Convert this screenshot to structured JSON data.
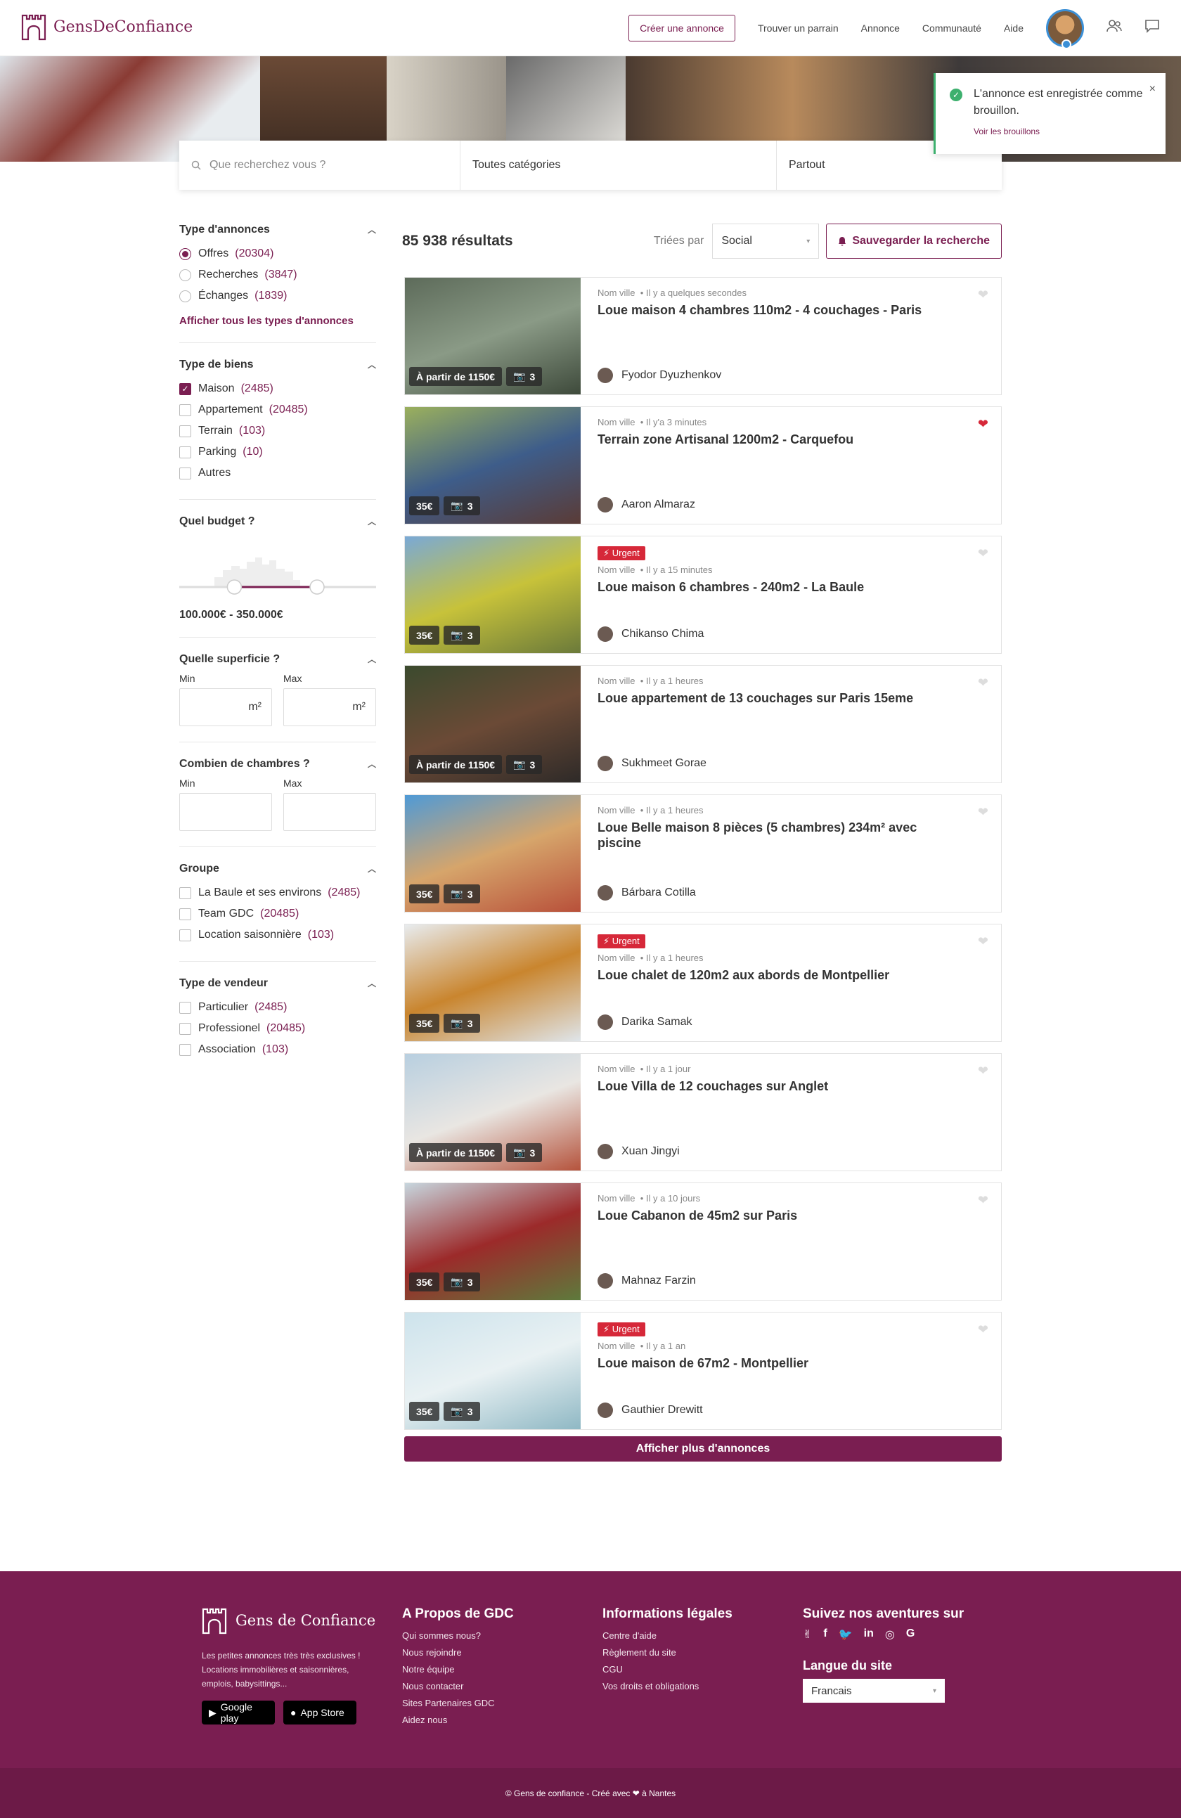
{
  "header": {
    "brand": "GensDeConfiance",
    "create_btn": "Créer une annonce",
    "nav": [
      "Trouver un parrain",
      "Annonce",
      "Communauté",
      "Aide"
    ]
  },
  "toast": {
    "message": "L'annonce est enregistrée comme brouillon.",
    "link": "Voir les brouillons",
    "close": "×"
  },
  "search": {
    "placeholder": "Que recherchez vous ?",
    "category": "Toutes catégories",
    "location": "Partout"
  },
  "filters": {
    "ad_type": {
      "title": "Type d'annonces",
      "options": [
        {
          "label": "Offres",
          "count": "(20304)",
          "checked": true
        },
        {
          "label": "Recherches",
          "count": "(3847)",
          "checked": false
        },
        {
          "label": "Échanges",
          "count": "(1839)",
          "checked": false
        }
      ],
      "show_all": "Afficher tous les types d'annonces"
    },
    "property_type": {
      "title": "Type de biens",
      "options": [
        {
          "label": "Maison",
          "count": "(2485)",
          "checked": true
        },
        {
          "label": "Appartement",
          "count": "(20485)",
          "checked": false
        },
        {
          "label": "Terrain",
          "count": "(103)",
          "checked": false
        },
        {
          "label": "Parking",
          "count": "(10)",
          "checked": false
        },
        {
          "label": "Autres",
          "count": "",
          "checked": false
        }
      ]
    },
    "budget": {
      "title": "Quel budget ?",
      "value": "100.000€ - 350.000€",
      "range_min_fraction": 0.28,
      "range_max_fraction": 0.7
    },
    "surface": {
      "title": "Quelle superficie ?",
      "min_label": "Min",
      "max_label": "Max",
      "unit": "m²"
    },
    "rooms": {
      "title": "Combien de chambres ?",
      "min_label": "Min",
      "max_label": "Max"
    },
    "group": {
      "title": "Groupe",
      "options": [
        {
          "label": "La Baule et ses environs",
          "count": "(2485)",
          "checked": false
        },
        {
          "label": "Team GDC",
          "count": "(20485)",
          "checked": false
        },
        {
          "label": "Location saisonnière",
          "count": "(103)",
          "checked": false
        }
      ]
    },
    "seller_type": {
      "title": "Type de vendeur",
      "options": [
        {
          "label": "Particulier",
          "count": "(2485)",
          "checked": false
        },
        {
          "label": "Professionel",
          "count": "(20485)",
          "checked": false
        },
        {
          "label": "Association",
          "count": "(103)",
          "checked": false
        }
      ]
    }
  },
  "results": {
    "count": "85 938 résultats",
    "sort_label": "Triées par",
    "sort_value": "Social",
    "save_search": "Sauvegarder la recherche",
    "more": "Afficher plus d'annonces",
    "listings": [
      {
        "city": "Nom ville",
        "time": "Il y a quelques secondes",
        "title": "Loue maison 4 chambres 110m2 - 4 couchages - Paris",
        "seller": "Fyodor Dyuzhenkov",
        "price": "À partir de 1150€",
        "photos": "3",
        "urgent": false,
        "liked": false,
        "img": [
          "#5d6b5a",
          "#8a9a86",
          "#3e4a3b"
        ]
      },
      {
        "city": "Nom ville",
        "time": "Il y'a 3 minutes",
        "title": "Terrain zone Artisanal  1200m2 - Carquefou",
        "seller": "Aaron Almaraz",
        "price": "35€",
        "photos": "3",
        "urgent": false,
        "liked": true,
        "img": [
          "#9bb05d",
          "#3e5d8a",
          "#5a3b36"
        ]
      },
      {
        "city": "Nom ville",
        "time": "Il y a 15 minutes",
        "title": "Loue maison 6 chambres - 240m2 - La Baule",
        "seller": "Chikanso Chima",
        "price": "35€",
        "photos": "3",
        "urgent": true,
        "liked": false,
        "img": [
          "#7aa9d6",
          "#c7c23a",
          "#6b7a3a"
        ]
      },
      {
        "city": "Nom ville",
        "time": "Il y a 1 heures",
        "title": "Loue appartement de 13 couchages sur Paris 15eme",
        "seller": "Sukhmeet Gorae",
        "price": "À partir de 1150€",
        "photos": "3",
        "urgent": false,
        "liked": false,
        "img": [
          "#3b4a2e",
          "#6b4a36",
          "#2e2a28"
        ]
      },
      {
        "city": "Nom ville",
        "time": "Il y a 1 heures",
        "title": "Loue Belle maison 8 pièces (5 chambres) 234m² avec piscine",
        "seller": "Bárbara Cotilla",
        "price": "35€",
        "photos": "3",
        "urgent": false,
        "liked": false,
        "img": [
          "#4f9ad6",
          "#d6a56b",
          "#b8503a"
        ]
      },
      {
        "city": "Nom ville",
        "time": "Il y a 1 heures",
        "title": "Loue chalet de 120m2 aux abords de Montpellier",
        "seller": "Darika Samak",
        "price": "35€",
        "photos": "3",
        "urgent": true,
        "liked": false,
        "img": [
          "#e8ecef",
          "#c9852e",
          "#dfe5ea"
        ]
      },
      {
        "city": "Nom ville",
        "time": "Il y a 1 jour",
        "title": "Loue Villa de 12 couchages sur Anglet",
        "seller": "Xuan Jingyi",
        "price": "À partir de 1150€",
        "photos": "3",
        "urgent": false,
        "liked": false,
        "img": [
          "#b8cfe0",
          "#e9e6e2",
          "#b5533c"
        ]
      },
      {
        "city": "Nom ville",
        "time": "Il y a 10 jours",
        "title": "Loue Cabanon de 45m2 sur Paris",
        "seller": "Mahnaz Farzin",
        "price": "35€",
        "photos": "3",
        "urgent": false,
        "liked": false,
        "img": [
          "#c7d6de",
          "#9c2a2a",
          "#5e7a3c"
        ]
      },
      {
        "city": "Nom ville",
        "time": "Il y a 1 an",
        "title": "Loue maison de 67m2 - Montpellier",
        "seller": "Gauthier Drewitt",
        "price": "35€",
        "photos": "3",
        "urgent": true,
        "liked": false,
        "img": [
          "#cde3ec",
          "#e9f1f3",
          "#8fb8c4"
        ]
      }
    ]
  },
  "footer": {
    "brand": "Gens de Confiance",
    "desc": "Les petites annonces très très exclusives ! Locations immobilières et saisonnières, emplois, babysittings...",
    "google_play": "Google play",
    "app_store": "App Store",
    "about": {
      "title": "A Propos de GDC",
      "links": [
        "Qui sommes nous?",
        "Nous rejoindre",
        "Notre équipe",
        "Nous contacter",
        "Sites Partenaires GDC",
        "Aidez nous"
      ]
    },
    "legal": {
      "title": "Informations légales",
      "links": [
        "Centre d'aide",
        "Règlement du site",
        "CGU",
        "Vos droits et obligations"
      ]
    },
    "social_title": "Suivez nos aventures sur",
    "lang_title": "Langue du site",
    "lang_value": "Francais",
    "copyright": "© Gens de confiance - Créé avec ❤ à Nantes"
  },
  "colors": {
    "brand": "#7a1e51",
    "urgent": "#d62839",
    "success": "#3db06e"
  }
}
